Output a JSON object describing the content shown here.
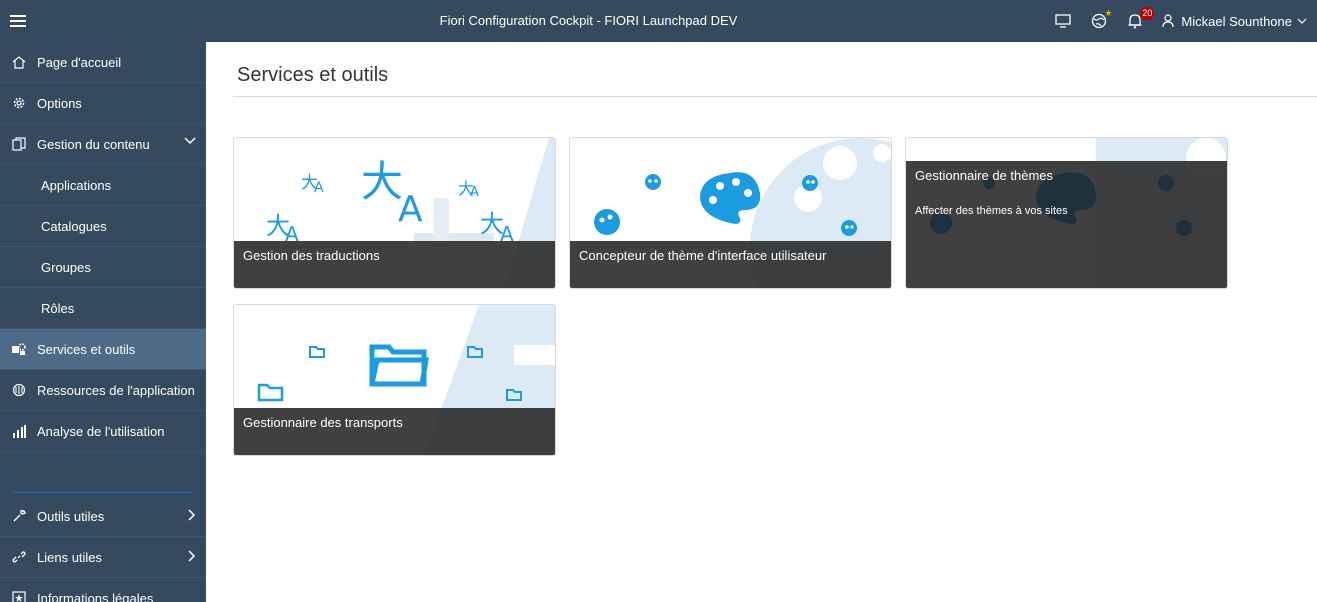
{
  "shell": {
    "title": "Fiori Configuration Cockpit - FIORI Launchpad DEV",
    "notification_count": "20",
    "user_name": "Mickael Sounthone"
  },
  "nav": {
    "home": "Page d'accueil",
    "options": "Options",
    "content_mgmt": "Gestion du contenu",
    "applications": "Applications",
    "catalogs": "Catalogues",
    "groups": "Groupes",
    "roles": "Rôles",
    "services": "Services et outils",
    "resources": "Ressources de l'application",
    "analytics": "Analyse de l'utilisation",
    "tools": "Outils utiles",
    "links": "Liens utiles",
    "legal": "Informations légales"
  },
  "page": {
    "title": "Services et outils"
  },
  "tiles": {
    "translations": "Gestion des traductions",
    "theme_designer": "Concepteur de thème d'interface utilisateur",
    "theme_manager": "Gestionnaire de thèmes",
    "theme_manager_sub": "Affecter des thèmes à vos sites",
    "transports": "Gestionnaire des transports"
  },
  "colors": {
    "shell": "#354a5f",
    "accent": "#0a6ed1",
    "tile_icon": "#1b9be0"
  },
  "icons": [
    "menu-icon",
    "monitor-icon",
    "globe-icon",
    "bell-icon",
    "user-icon",
    "chevron-down-icon",
    "home-icon",
    "gear-icon",
    "copy-icon",
    "wrench-icon",
    "link-icon"
  ]
}
